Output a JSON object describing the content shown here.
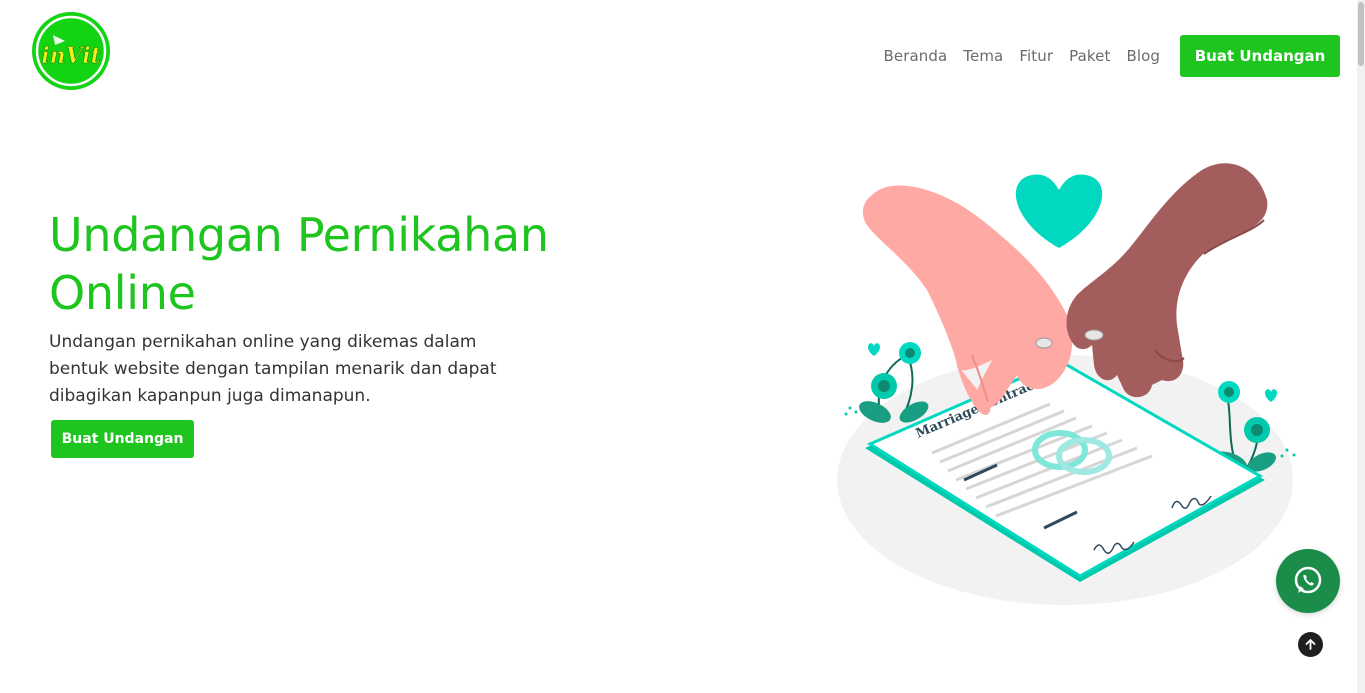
{
  "header": {
    "logo_text": "inVit",
    "nav_items": [
      {
        "label": "Beranda"
      },
      {
        "label": "Tema"
      },
      {
        "label": "Fitur"
      },
      {
        "label": "Paket"
      },
      {
        "label": "Blog"
      }
    ],
    "cta_label": "Buat Undangan"
  },
  "hero": {
    "title": "Undangan Pernikahan Online",
    "description": "Undangan pernikahan online yang dikemas dalam bentuk website dengan tampilan menarik dan dapat dibagikan kapanpun juga dimanapun.",
    "cta_label": "Buat Undangan",
    "illustration": {
      "document_title": "Marriage contract"
    }
  },
  "floating": {
    "whatsapp_icon": "whatsapp-icon",
    "scroll_top_icon": "arrow-up-icon"
  },
  "colors": {
    "brand_green": "#1ec51e",
    "teal": "#00d9c0",
    "whatsapp_green": "#1b8c4a"
  }
}
